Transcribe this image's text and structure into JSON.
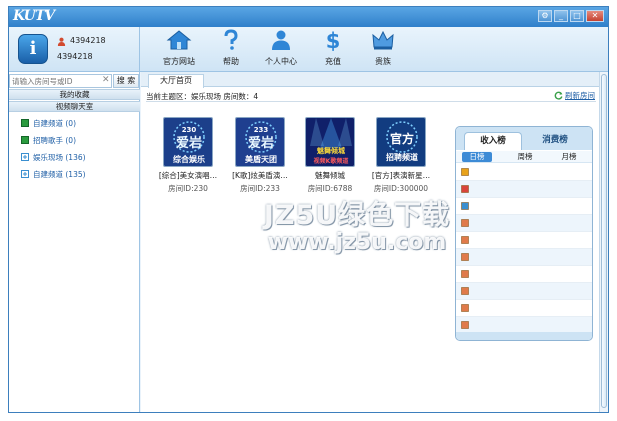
{
  "app": {
    "logo": "KUTV"
  },
  "window_controls": [
    "⚙",
    "_",
    "□",
    "✕"
  ],
  "user": {
    "id_primary": "4394218",
    "id_secondary": "4394218"
  },
  "nav": [
    {
      "label": "官方网站",
      "icon": "home-icon"
    },
    {
      "label": "帮助",
      "icon": "help-icon"
    },
    {
      "label": "个人中心",
      "icon": "person-icon"
    },
    {
      "label": "充值",
      "icon": "dollar-icon"
    },
    {
      "label": "贵族",
      "icon": "crown-icon"
    }
  ],
  "sidebar": {
    "search_placeholder": "请输入房间号或ID",
    "search_button": "搜 索",
    "sections": [
      "我的收藏",
      "视频聊天室"
    ],
    "channels": [
      {
        "label": "自建频道 (0)",
        "color": "#2a9b3e"
      },
      {
        "label": "招聘歌手 (0)",
        "color": "#2a9b3e"
      },
      {
        "label": "娱乐现场 (136)",
        "color": "#3a8fd0"
      },
      {
        "label": "自建频道 (135)",
        "color": "#3a8fd0"
      }
    ]
  },
  "main": {
    "tab": "大厅首页",
    "breadcrumb": "当前主题区：娱乐现场 房间数：4",
    "refresh": "刷新房间",
    "rooms": [
      {
        "name": "[综合]美女演唱…",
        "id": "房间ID:230",
        "thumb_line1": "230",
        "thumb_line2": "爱岩",
        "thumb_line3": "综合娱乐",
        "thumb_bg": "#1c3f8a"
      },
      {
        "name": "[K歌]炫美盾演…",
        "id": "房间ID:233",
        "thumb_line1": "233",
        "thumb_line2": "爱岩",
        "thumb_line3": "美盾天团",
        "thumb_bg": "#1f3f8f"
      },
      {
        "name": "魅舞倾城",
        "id": "房间ID:6788",
        "thumb_line1": "",
        "thumb_line2": "魅舞倾城",
        "thumb_line3": "视频K歌频道",
        "thumb_bg": "#10206a"
      },
      {
        "name": "[官方]表演新星…",
        "id": "房间ID:300000",
        "thumb_line1": "",
        "thumb_line2": "官方",
        "thumb_line3": "招聘频道",
        "thumb_bg": "#123c80"
      }
    ]
  },
  "rank": {
    "tabs": [
      "收入榜",
      "消费榜"
    ],
    "periods": [
      "日榜",
      "周榜",
      "月榜"
    ],
    "rows": 10
  },
  "watermark": {
    "line1": "JZ5U绿色下载",
    "line2": "www.jz5u.com"
  }
}
